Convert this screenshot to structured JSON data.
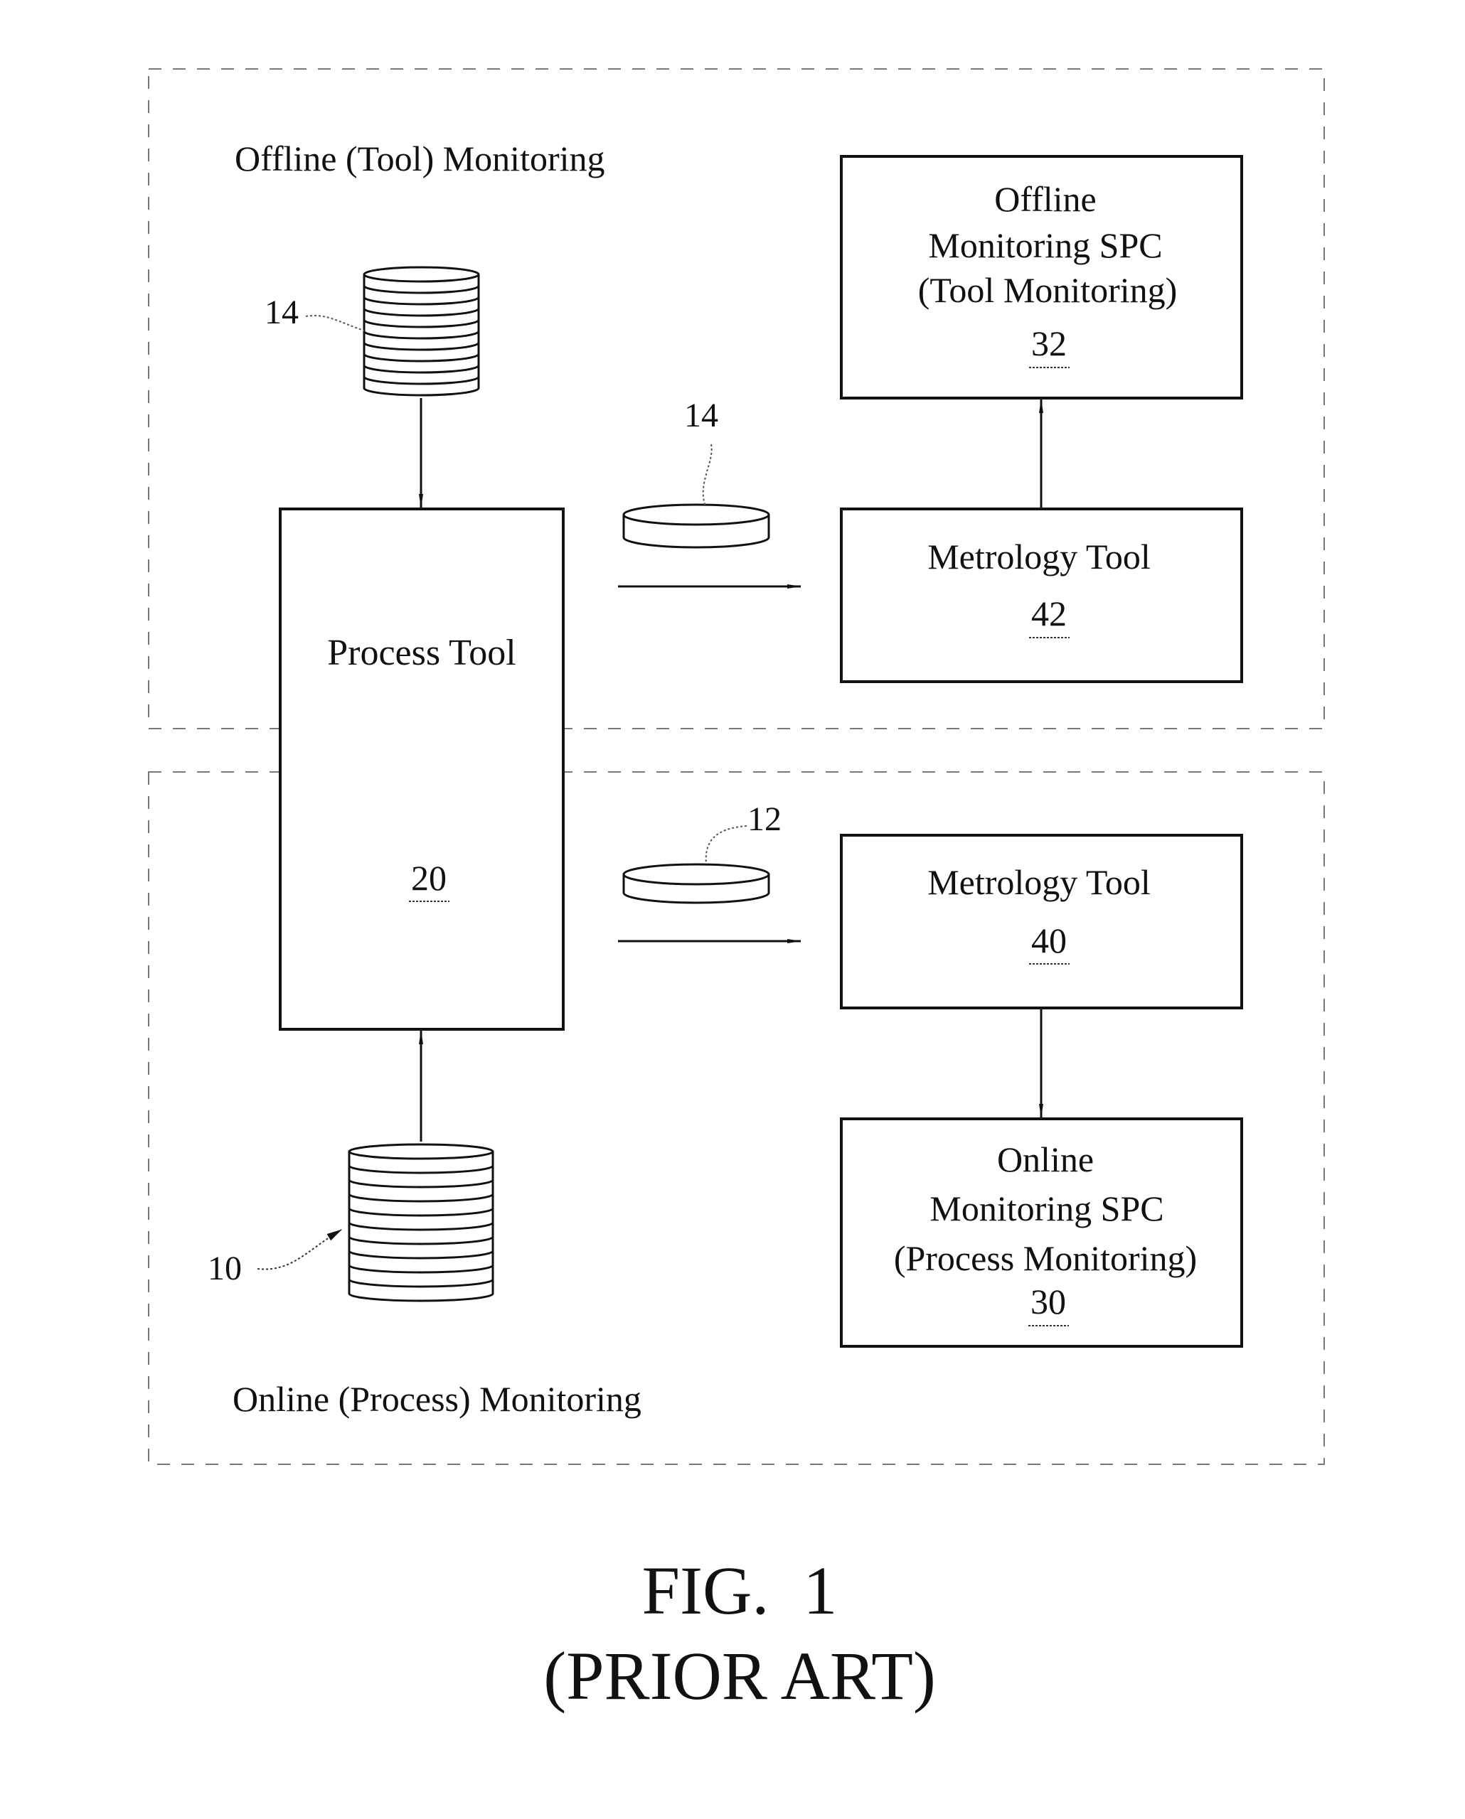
{
  "figure": {
    "caption": "FIG.  1",
    "subcaption": "(PRIOR ART)"
  },
  "regions": {
    "offline": {
      "label": "Offline (Tool) Monitoring"
    },
    "online": {
      "label": "Online (Process) Monitoring"
    }
  },
  "process_tool": {
    "label": "Process Tool",
    "ref": "20"
  },
  "stacks": {
    "monitor_wafers": {
      "ref": "14"
    },
    "product_wafers": {
      "ref": "10"
    }
  },
  "wafers": {
    "monitor_wafer": {
      "ref": "14"
    },
    "product_wafer": {
      "ref": "12"
    }
  },
  "boxes": {
    "offline_spc": {
      "lines": [
        "Offline",
        "Monitoring SPC",
        "(Tool Monitoring)"
      ],
      "ref": "32"
    },
    "metrology_42": {
      "lines": [
        "Metrology Tool"
      ],
      "ref": "42"
    },
    "metrology_40": {
      "lines": [
        "Metrology Tool"
      ],
      "ref": "40"
    },
    "online_spc": {
      "lines": [
        "Online",
        "Monitoring SPC",
        "(Process Monitoring)"
      ],
      "ref": "30"
    }
  }
}
